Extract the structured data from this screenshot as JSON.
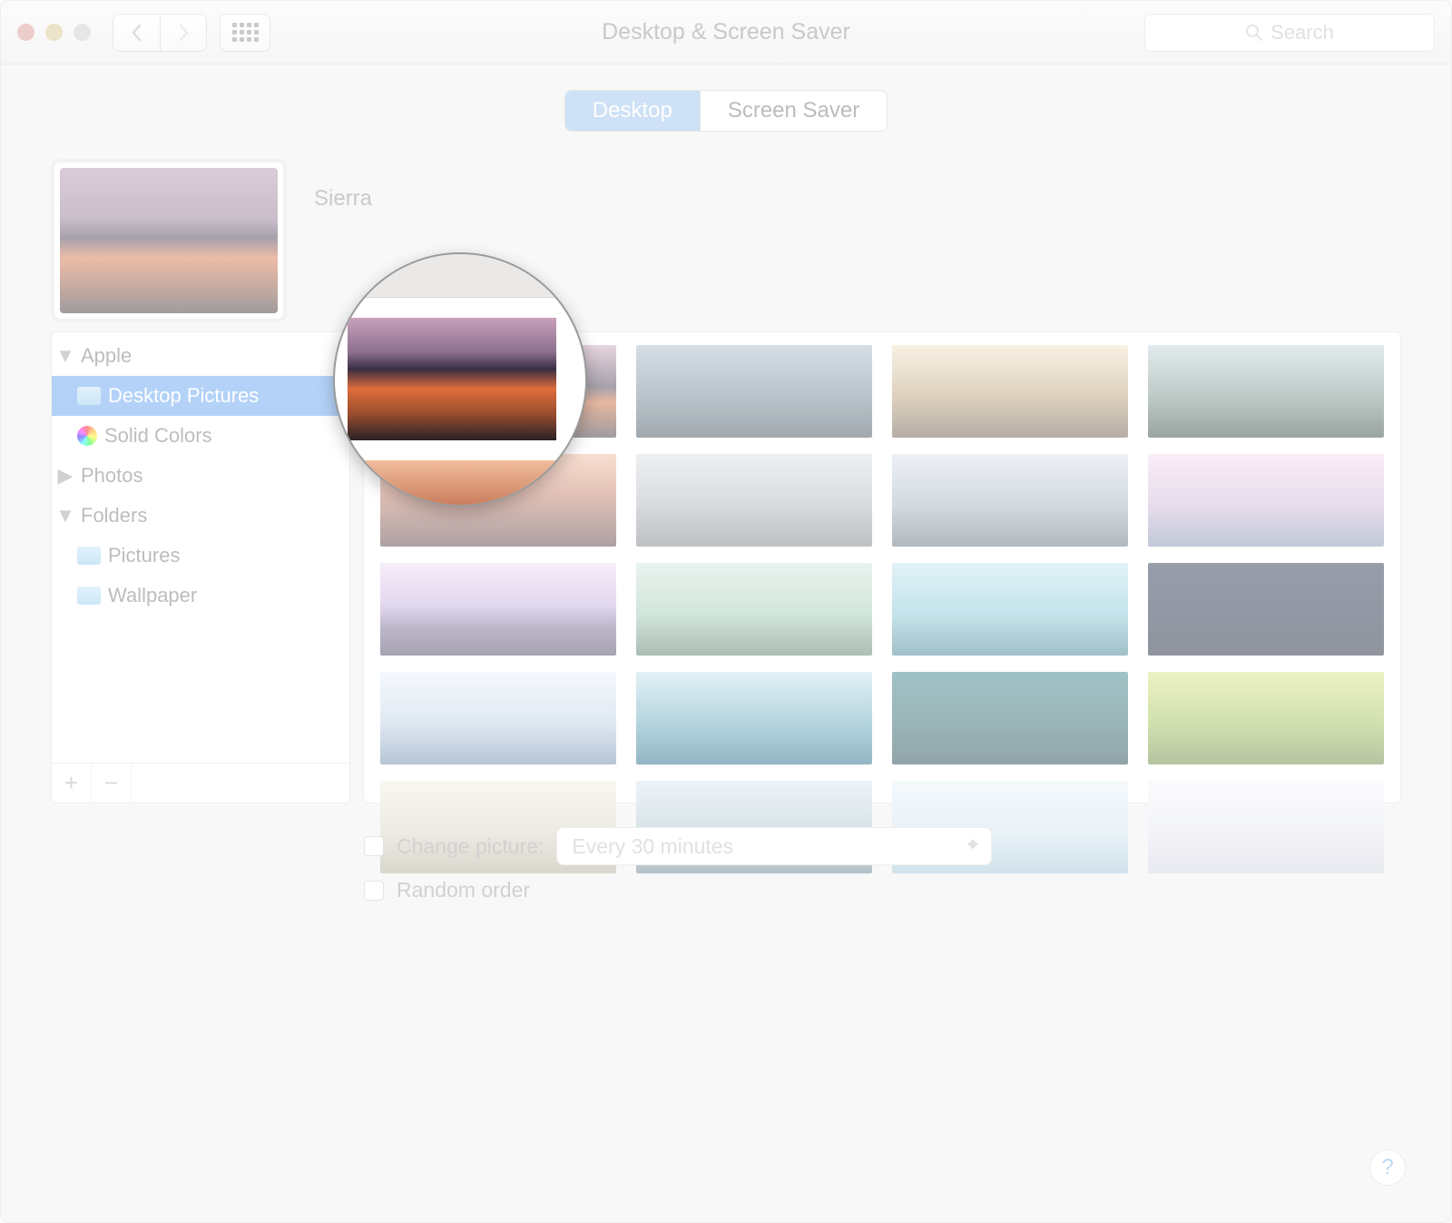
{
  "window": {
    "title": "Desktop & Screen Saver"
  },
  "search": {
    "placeholder": "Search"
  },
  "tabs": {
    "desktop": "Desktop",
    "screensaver": "Screen Saver"
  },
  "preview": {
    "name": "Sierra"
  },
  "sidebar": {
    "apple": "Apple",
    "desktop_pictures": "Desktop Pictures",
    "solid_colors": "Solid Colors",
    "photos": "Photos",
    "folders": "Folders",
    "pictures": "Pictures",
    "wallpaper": "Wallpaper"
  },
  "options": {
    "change_picture": "Change picture:",
    "interval": "Every 30 minutes",
    "random_order": "Random order"
  },
  "help": "?"
}
